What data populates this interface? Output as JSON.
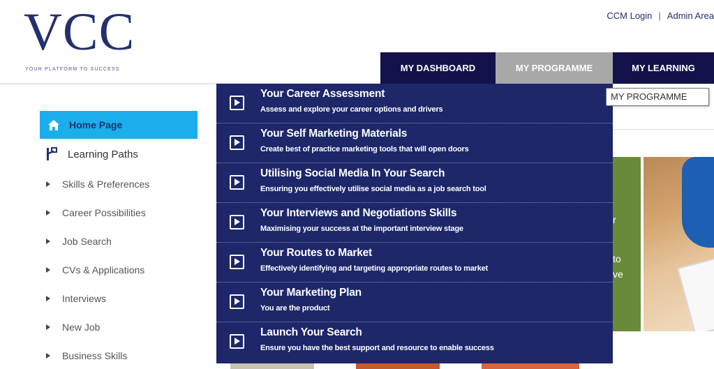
{
  "brand": {
    "logo": "VCC",
    "tagline": "YOUR PLATFORM TO SUCCESS"
  },
  "top_links": {
    "ccm_login": "CCM Login",
    "separator": "|",
    "admin_area": "Admin Area"
  },
  "nav": {
    "items": [
      {
        "label": "MY DASHBOARD",
        "active": false
      },
      {
        "label": "MY PROGRAMME",
        "active": true
      },
      {
        "label": "MY LEARNING",
        "active": false
      }
    ],
    "tooltip": "MY PROGRAMME"
  },
  "sidebar": {
    "home": {
      "label": "Home Page",
      "icon": "home-icon"
    },
    "paths": {
      "label": "Learning Paths",
      "icon": "branch-icon"
    },
    "links": [
      {
        "label": "Skills & Preferences"
      },
      {
        "label": "Career Possibilities"
      },
      {
        "label": "Job Search"
      },
      {
        "label": "CVs & Applications"
      },
      {
        "label": "Interviews"
      },
      {
        "label": "New Job"
      },
      {
        "label": "Business Skills"
      }
    ]
  },
  "dropdown": {
    "items": [
      {
        "title": "Your Career Assessment",
        "desc": "Assess and explore your career options and drivers"
      },
      {
        "title": "Your Self Marketing Materials",
        "desc": "Create best of practice marketing tools that will open doors"
      },
      {
        "title": "Utilising Social Media In Your Search",
        "desc": "Ensuring you effectively utilise social media as a job search tool"
      },
      {
        "title": "Your Interviews and Negotiations Skills",
        "desc": "Maximising your success at the important interview stage"
      },
      {
        "title": "Your Routes to Market",
        "desc": "Effectively identifying and targeting appropriate routes to market"
      },
      {
        "title": "Your Marketing Plan",
        "desc": "You are the product"
      },
      {
        "title": "Launch Your Search",
        "desc": "Ensure you have the best support and resource to enable success"
      }
    ]
  },
  "hero": {
    "fragments": [
      "r",
      "to",
      "ve"
    ]
  },
  "colors": {
    "navy": "#13124b",
    "dropdown": "#1d2769",
    "active_tab": "#a8a8a8",
    "home_highlight": "#1aaeec",
    "brand_text": "#22306b"
  }
}
